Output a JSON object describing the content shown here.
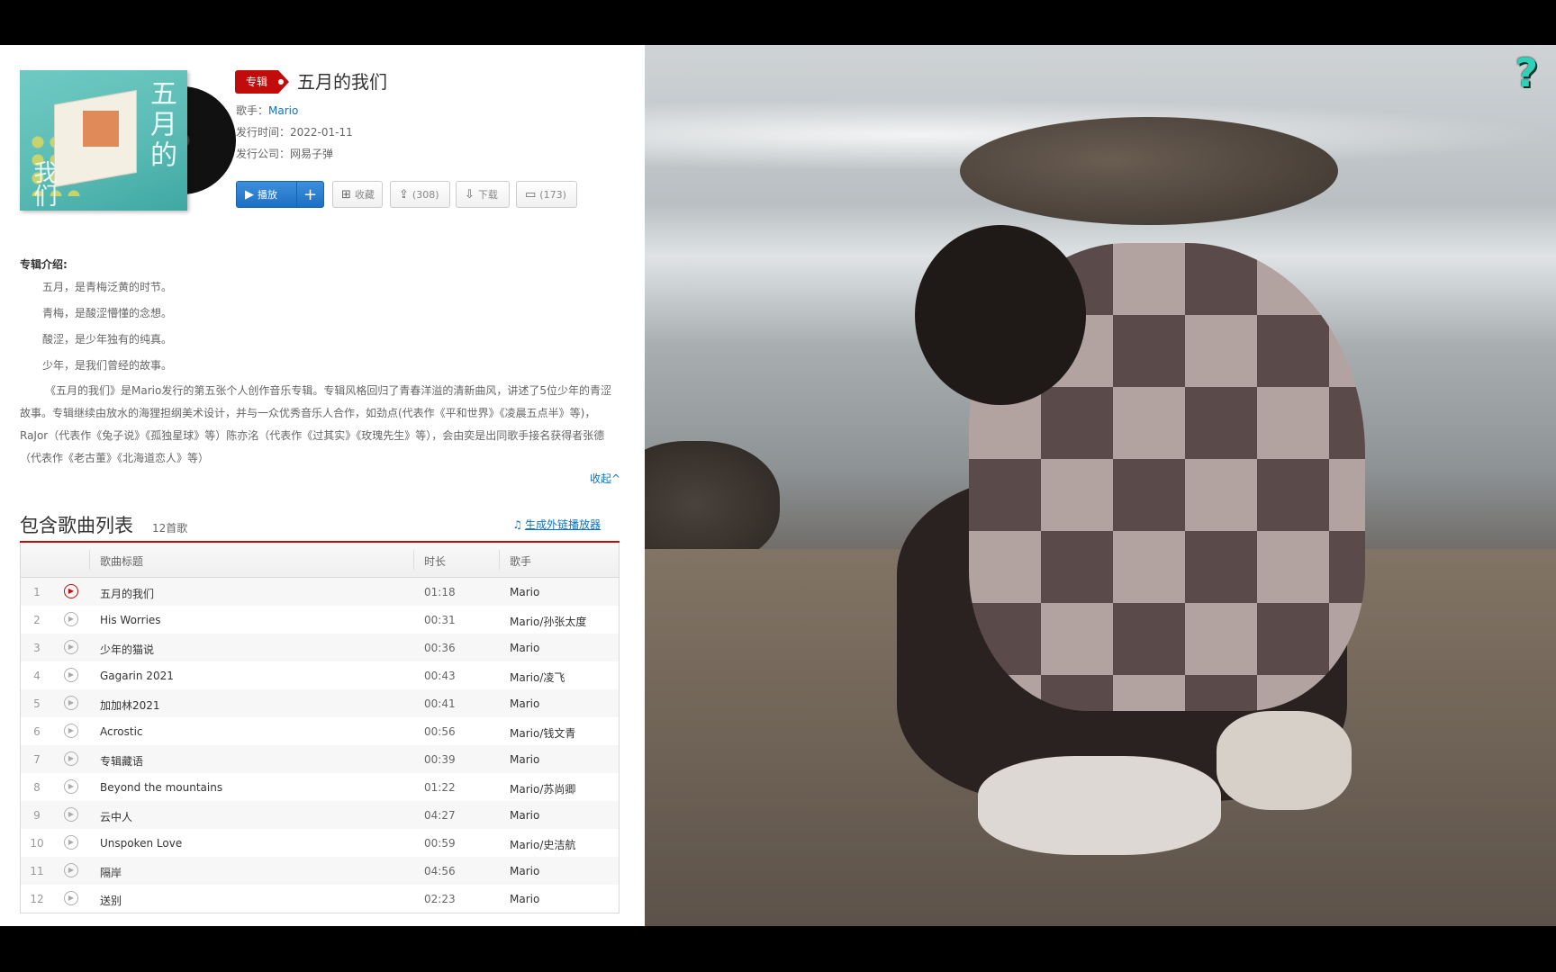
{
  "album": {
    "badge": "专辑",
    "title": "五月的我们",
    "singer_label": "歌手：",
    "singer": "Mario",
    "release_label": "发行时间：",
    "release_date": "2022-01-11",
    "company_label": "发行公司：",
    "company": "网易子弹",
    "cover_art_text": "五月的",
    "cover_art_text2": "我们"
  },
  "actions": {
    "play": "播放",
    "plus": "+",
    "favorite": "收藏",
    "share": "(308)",
    "download": "下载",
    "comment": "(173)"
  },
  "intro": {
    "heading": "专辑介绍:",
    "lines": [
      "五月，是青梅泛黄的时节。",
      "青梅，是酸涩懵懂的念想。",
      "酸涩，是少年独有的纯真。",
      "少年，是我们曾经的故事。"
    ],
    "long": "《五月的我们》是Mario发行的第五张个人创作音乐专辑。专辑风格回归了青春洋溢的清新曲风，讲述了5位少年的青涩故事。专辑继续由放水的海狸担纲美术设计，并与一众优秀音乐人合作，如劲点(代表作《平和世界》《凌晨五点半》等)，RaJor（代表作《兔子说》《孤独星球》等）陈亦洺（代表作《过其实》《玫瑰先生》等），会由奕是出同歌手接名获得者张德（代表作《老古董》《北海道恋人》等）",
    "collapse": "收起^"
  },
  "tracklist": {
    "title": "包含歌曲列表",
    "count": "12首歌",
    "link": "生成外链播放器",
    "col_title": "歌曲标题",
    "col_duration": "时长",
    "col_artist": "歌手",
    "tracks": [
      {
        "num": "1",
        "name": "五月的我们",
        "duration": "01:18",
        "artist": "Mario"
      },
      {
        "num": "2",
        "name": "His Worries",
        "duration": "00:31",
        "artist": "Mario/孙张太度"
      },
      {
        "num": "3",
        "name": "少年的猫说",
        "duration": "00:36",
        "artist": "Mario"
      },
      {
        "num": "4",
        "name": "Gagarin 2021",
        "duration": "00:43",
        "artist": "Mario/凌飞"
      },
      {
        "num": "5",
        "name": "加加林2021",
        "duration": "00:41",
        "artist": "Mario"
      },
      {
        "num": "6",
        "name": "Acrostic",
        "duration": "00:56",
        "artist": "Mario/钱文青"
      },
      {
        "num": "7",
        "name": "专辑藏语",
        "duration": "00:39",
        "artist": "Mario"
      },
      {
        "num": "8",
        "name": "Beyond the mountains",
        "duration": "01:22",
        "artist": "Mario/苏尚卿"
      },
      {
        "num": "9",
        "name": "云中人",
        "duration": "04:27",
        "artist": "Mario"
      },
      {
        "num": "10",
        "name": "Unspoken Love",
        "duration": "00:59",
        "artist": "Mario/史洁航"
      },
      {
        "num": "11",
        "name": "隔岸",
        "duration": "04:56",
        "artist": "Mario"
      },
      {
        "num": "12",
        "name": "送别",
        "duration": "02:23",
        "artist": "Mario"
      }
    ]
  },
  "overlay": {
    "help": "?"
  },
  "colors": {
    "accent_red": "#c20c0c",
    "link_blue": "#0c73c2",
    "help_teal": "#2fd1b8"
  }
}
